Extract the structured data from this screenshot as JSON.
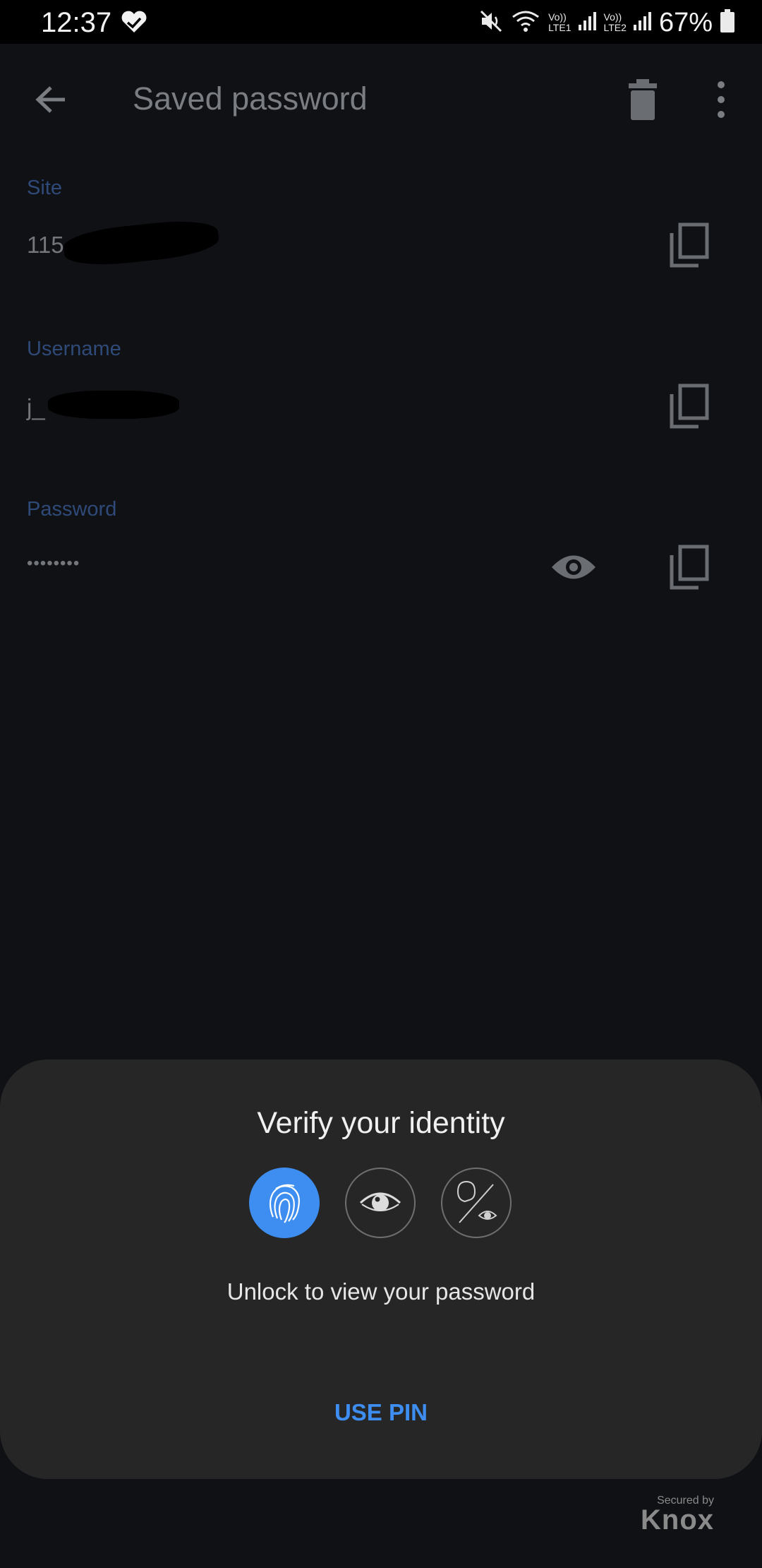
{
  "status_bar": {
    "time": "12:37",
    "battery": "67%",
    "sim1_label": "Vo))",
    "sim1_sub": "LTE1",
    "sim2_label": "Vo))",
    "sim2_sub": "LTE2"
  },
  "app_bar": {
    "title": "Saved password"
  },
  "fields": {
    "site": {
      "label": "Site",
      "value": "115"
    },
    "username": {
      "label": "Username",
      "value": "j_"
    },
    "password": {
      "label": "Password",
      "value": "••••••••"
    }
  },
  "sheet": {
    "title": "Verify your identity",
    "subtitle": "Unlock to view your password",
    "pin_button": "USE PIN"
  },
  "footer": {
    "secured_by": "Secured by",
    "brand": "Knox"
  },
  "colors": {
    "accent": "#3d8ef0",
    "background": "#0f1115",
    "sheet": "#262626"
  }
}
